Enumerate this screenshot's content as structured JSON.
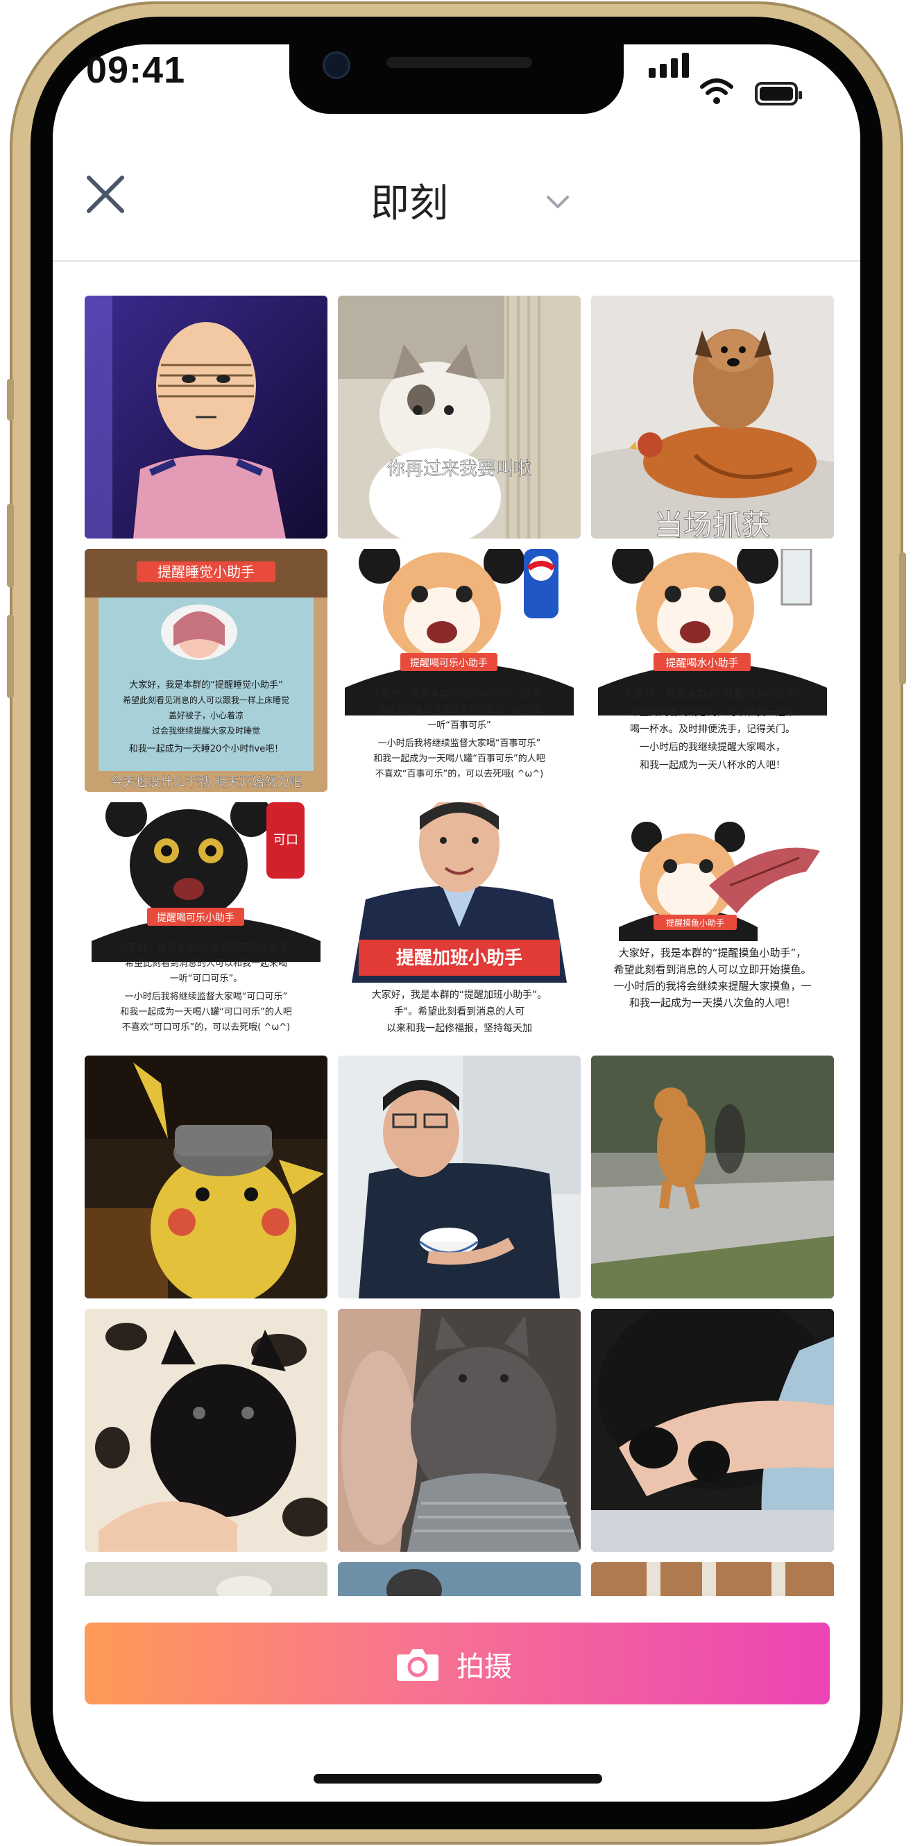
{
  "status_bar": {
    "time": "09:41"
  },
  "header": {
    "title": "即刻"
  },
  "gallery": {
    "tiles": [
      {
        "id": "saitama",
        "caption": ""
      },
      {
        "id": "cat-wall",
        "caption": "你再过来我要叫啦"
      },
      {
        "id": "dog-chicken",
        "caption": "当场抓获"
      },
      {
        "id": "sleep-helper",
        "badge": "提醒睡觉小助手",
        "caption": "大家好，我是本群的“提醒睡觉小助手”",
        "footer": "今天也没什么干劲 明天开始努力吧"
      },
      {
        "id": "pepsi-cat",
        "badge": "提醒喝可乐小助手",
        "caption": "大家好，我是本群的“提醒喝可乐小助手”",
        "footer": "不喜欢“百事可乐”的，可以去死哦( ^ω^)"
      },
      {
        "id": "water-cat",
        "badge": "提醒喝水小助手",
        "caption": "大家好，我是本群的“提醒喝水小助手”",
        "footer": "和我一起成为一天八杯水的人吧！"
      },
      {
        "id": "coke-cat",
        "badge": "提醒喝可乐小助手",
        "caption": "大家好，我是本群的“提醒喝可乐小助手”",
        "footer": "不喜欢“可口可乐”的，可以去死哦( ^ω^)"
      },
      {
        "id": "overtime",
        "badge": "提醒加班小助手",
        "caption": "大家好，我是本群的“提醒加班小助手”。"
      },
      {
        "id": "fish-cat",
        "badge": "提醒摸鱼小助手",
        "caption": "大家好，我是本群的“提醒摸鱼小助手”，",
        "footer": "和我一起成为一天摸八次鱼的人吧！"
      },
      {
        "id": "pikachu",
        "caption": ""
      },
      {
        "id": "man-bowl",
        "caption": ""
      },
      {
        "id": "orange-cat",
        "caption": ""
      },
      {
        "id": "black-kitten",
        "caption": ""
      },
      {
        "id": "grey-cat",
        "caption": ""
      },
      {
        "id": "cat-arm",
        "caption": ""
      }
    ]
  },
  "shoot_button": {
    "label": "拍摄"
  },
  "colors": {
    "gradient_start": "#ff9a57",
    "gradient_end": "#ec44b5"
  }
}
